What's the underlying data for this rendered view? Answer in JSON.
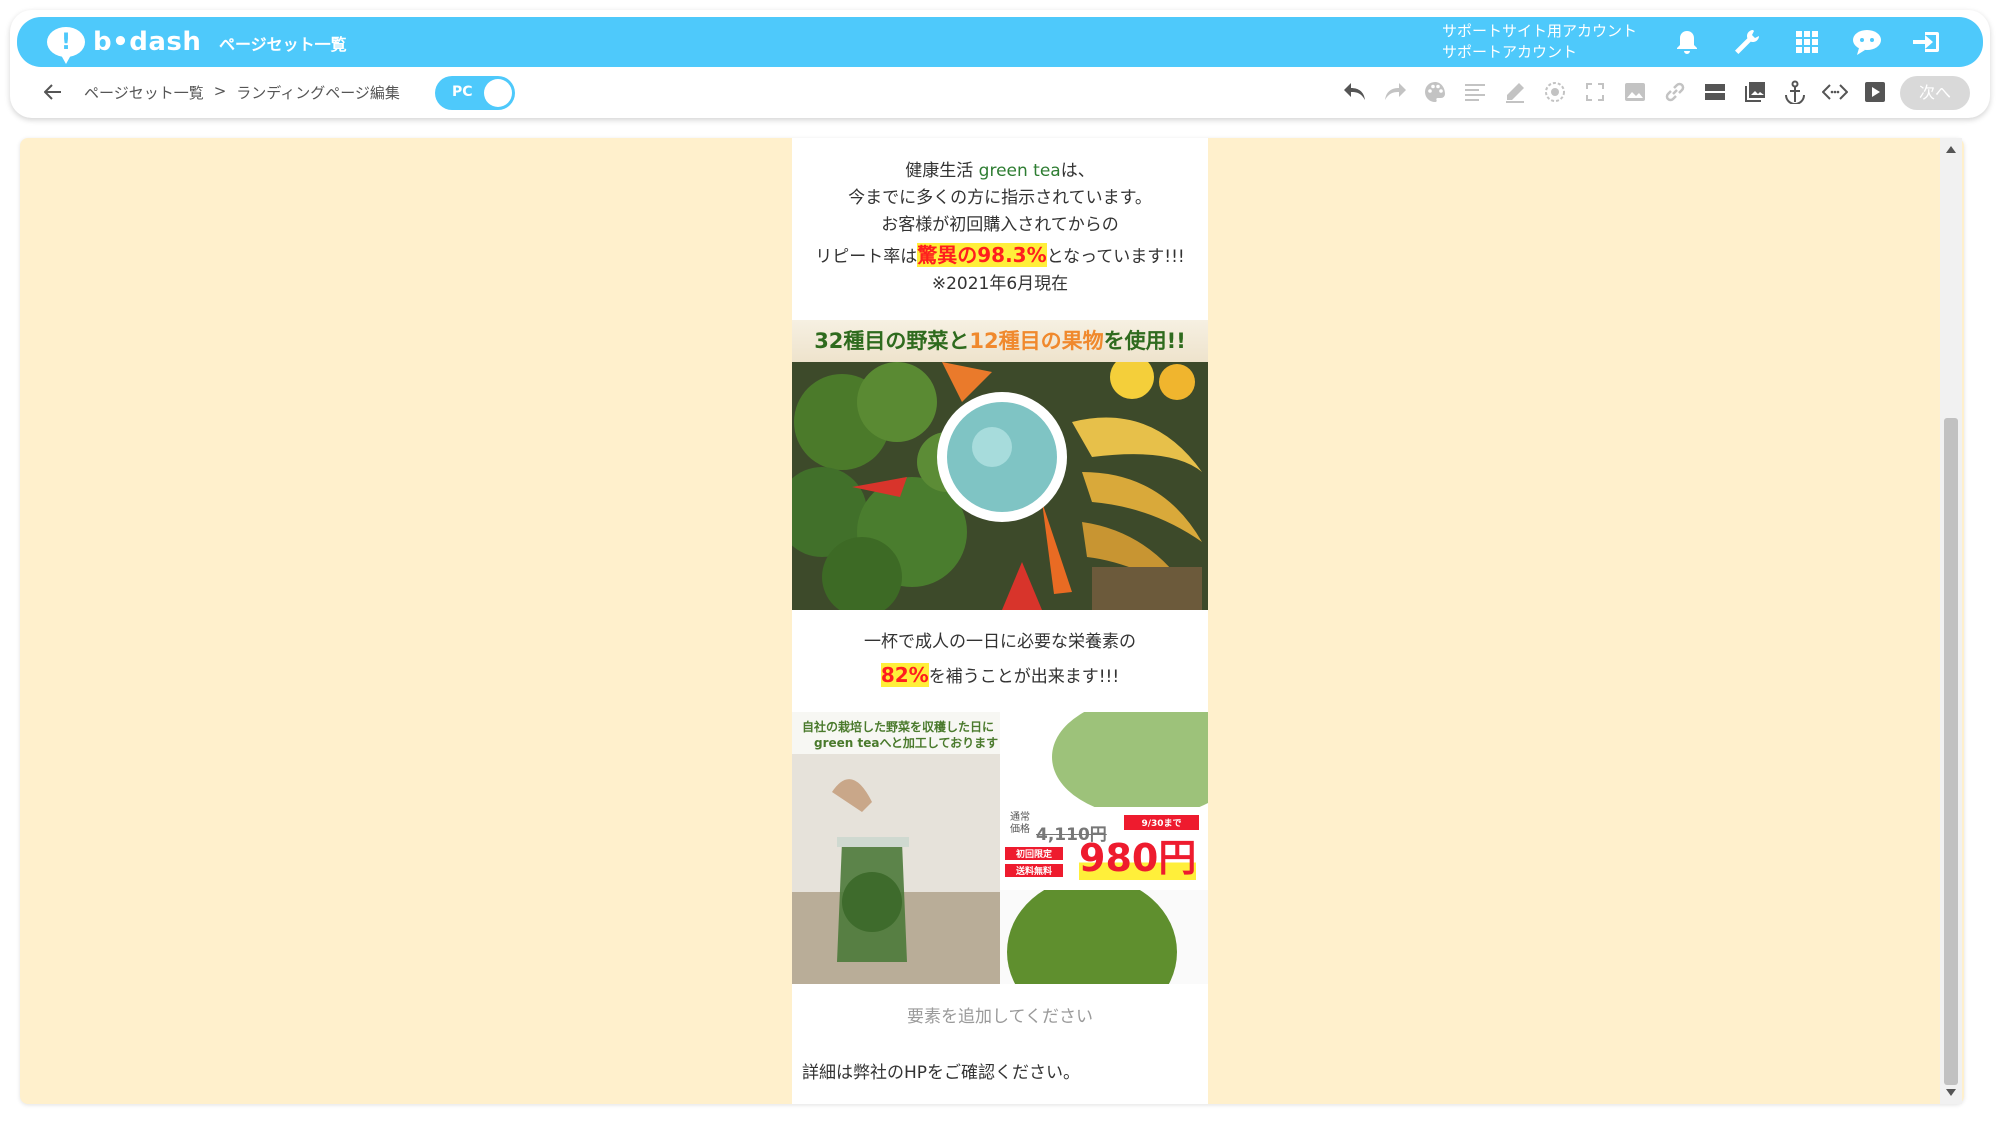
{
  "header": {
    "logo_text": "b•dash",
    "nav_title": "ページセット一覧",
    "account_line1": "サポートサイト用アカウント",
    "account_line2": "サポートアカウント",
    "icons": [
      "bell-icon",
      "wrench-icon",
      "apps-grid-icon",
      "chat-icon",
      "logout-icon"
    ]
  },
  "toolbar": {
    "breadcrumb": [
      "ページセット一覧",
      ">",
      "ランディングページ編集"
    ],
    "toggle_label": "PC",
    "next_label": "次へ",
    "tools": [
      "undo-icon",
      "redo-icon",
      "palette-icon",
      "align-icon",
      "pen-icon",
      "target-icon",
      "fullscreen-icon",
      "image-icon",
      "link-icon",
      "section-icon",
      "gallery-icon",
      "anchor-icon",
      "code-icon",
      "play-icon"
    ]
  },
  "page": {
    "intro_line1_pre": "健康生活 ",
    "intro_line1_green": "green tea",
    "intro_line1_post": "は、",
    "intro_line2": "今までに多くの方に指示されています。",
    "intro_line3": "お客様が初回購入されてからの",
    "intro_line4_pre": "リピート率は",
    "intro_line4_hl": "驚異の98.3%",
    "intro_line4_post": "となっています!!!",
    "intro_line5": "※2021年6月現在",
    "veg_title_a": "32種目の野菜",
    "veg_title_b": "と",
    "veg_title_c": "12種目の果物",
    "veg_title_d": "を使用!!",
    "mid_line1": "一杯で成人の一日に必要な栄養素の",
    "mid_hl": "82%",
    "mid_line2_post": "を補うことが出来ます!!!",
    "promo_caption1": "自社の栽培した野菜を収穫した日に",
    "promo_caption2": "green teaへと加工しております",
    "promo_regular_label1": "通常",
    "promo_regular_label2": "価格",
    "promo_regular_price": "4,110円",
    "promo_deadline": "9/30まで",
    "promo_tag1": "初回限定",
    "promo_tag2": "送料無料",
    "promo_price": "980円",
    "add_element": "要素を追加してください",
    "detail": "詳細は弊社のHPをご確認ください。"
  },
  "colors": {
    "header_blue": "#4ec9fb",
    "canvas_bg": "#fff0cc",
    "highlight_red": "#ff1e1e",
    "highlight_yellow": "#ffef3a"
  }
}
